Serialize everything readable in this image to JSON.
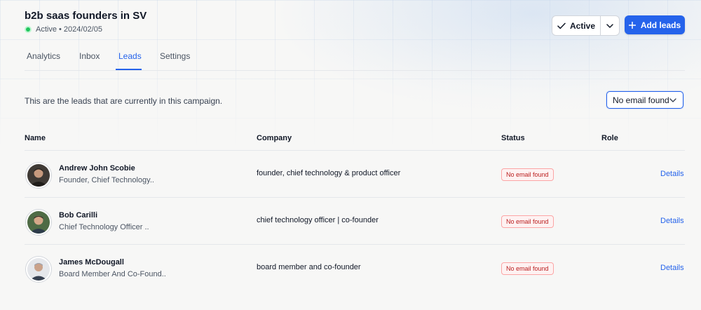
{
  "campaign": {
    "title": "b2b saas founders in SV",
    "subtitle": "Active • 2024/02/05"
  },
  "header_actions": {
    "status_label": "Active",
    "add_leads_label": "Add leads"
  },
  "tabs": [
    {
      "label": "Analytics",
      "active": false
    },
    {
      "label": "Inbox",
      "active": false
    },
    {
      "label": "Leads",
      "active": true
    },
    {
      "label": "Settings",
      "active": false
    }
  ],
  "leads_section": {
    "description": "This are the leads that are currently in this campaign.",
    "filter_value": "No email found",
    "columns": [
      "Name",
      "Company",
      "Status",
      "Role"
    ]
  },
  "leads": [
    {
      "name": "Andrew John Scobie",
      "title": "Founder, Chief Technology..",
      "company": "founder, chief technology & product officer",
      "status": "No email found",
      "action": "Details"
    },
    {
      "name": "Bob Carilli",
      "title": "Chief Technology Officer ..",
      "company": "chief technology officer | co-founder",
      "status": "No email found",
      "action": "Details"
    },
    {
      "name": "James McDougall",
      "title": "Board Member And Co-Found..",
      "company": "board member and co-founder",
      "status": "No email found",
      "action": "Details"
    }
  ],
  "colors": {
    "accent": "#2563eb",
    "status_active": "#22c55e",
    "badge_text": "#b91c1c",
    "badge_border": "#fca5a5"
  },
  "icons": [
    "status-dot",
    "check-icon",
    "chevron-down-icon",
    "plus-icon"
  ]
}
